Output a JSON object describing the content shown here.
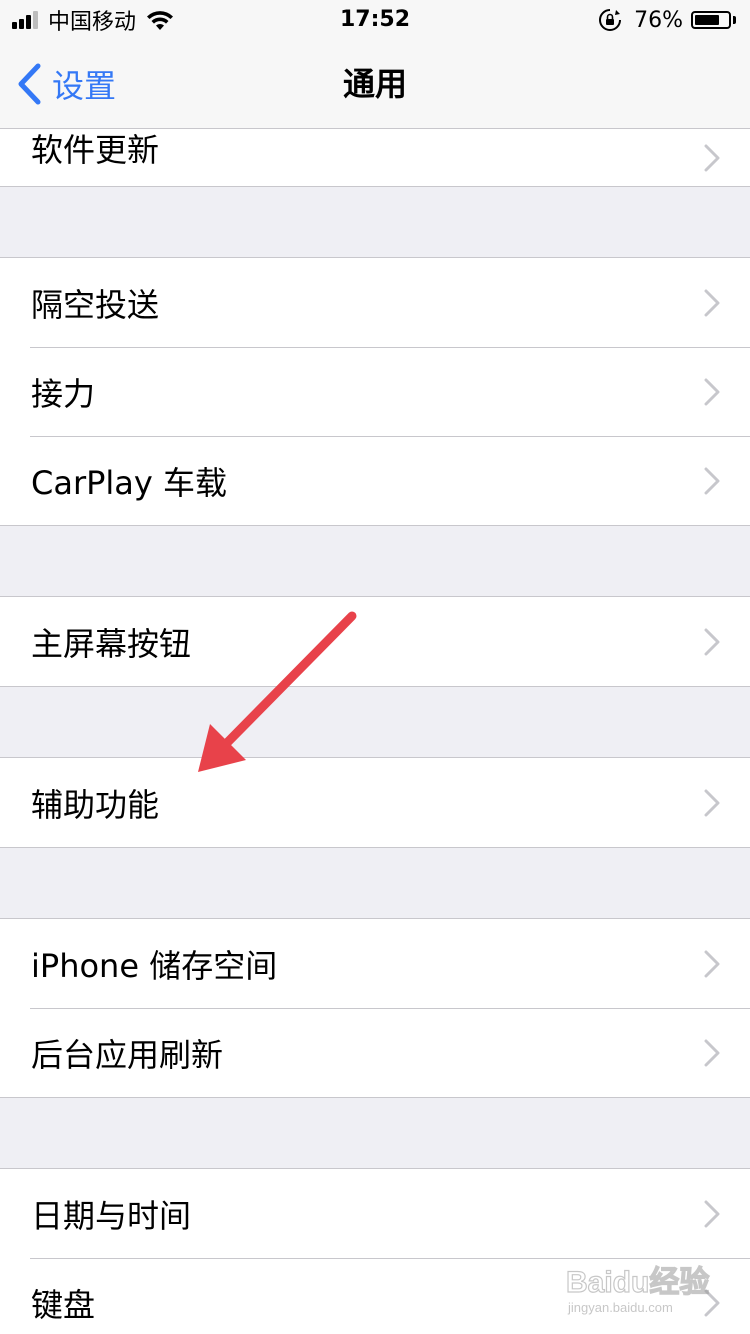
{
  "status_bar": {
    "carrier": "中国移动",
    "time": "17:52",
    "battery_percent": "76%",
    "battery_level": 0.76,
    "signal_bars_filled": 3,
    "signal_bars_total": 4,
    "icons": [
      "signal-icon",
      "wifi-icon",
      "rotation-lock-icon",
      "battery-icon"
    ]
  },
  "nav": {
    "back_label": "设置",
    "title": "通用",
    "accent_color": "#3478f6"
  },
  "groups": [
    {
      "items": [
        {
          "label": "软件更新"
        }
      ]
    },
    {
      "items": [
        {
          "label": "隔空投送"
        },
        {
          "label": "接力"
        },
        {
          "label": "CarPlay 车载"
        }
      ]
    },
    {
      "items": [
        {
          "label": "主屏幕按钮"
        }
      ]
    },
    {
      "items": [
        {
          "label": "辅助功能"
        }
      ]
    },
    {
      "items": [
        {
          "label": "iPhone 储存空间"
        },
        {
          "label": "后台应用刷新"
        }
      ]
    },
    {
      "items": [
        {
          "label": "日期与时间"
        },
        {
          "label": "键盘"
        }
      ]
    }
  ],
  "annotation": {
    "type": "arrow",
    "color": "#e8424a",
    "points_to": "辅助功能"
  },
  "watermark": {
    "text": "Baidu经验",
    "subtext": "jingyan.baidu.com"
  }
}
